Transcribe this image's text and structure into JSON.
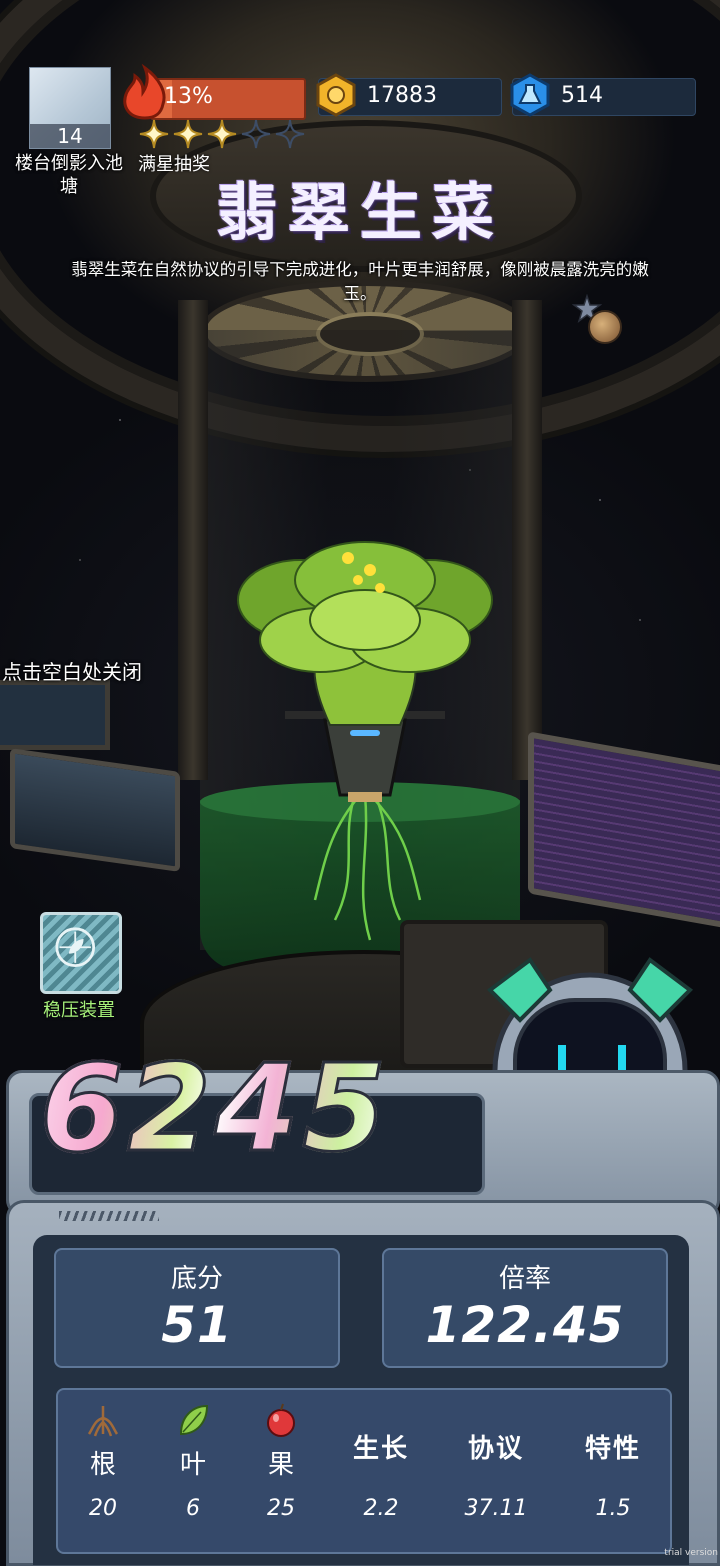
{
  "hud": {
    "level": {
      "number": "14",
      "label": "楼台倒影入池塘"
    },
    "heat": {
      "percent_text": "13%",
      "percent": 13
    },
    "stars": {
      "filled": 3,
      "total": 5,
      "label": "满星抽奖"
    },
    "coins": {
      "value": "17883",
      "icon": "gold-hexagon-coin-icon"
    },
    "gems": {
      "value": "514",
      "icon": "blue-flask-gem-icon"
    }
  },
  "plant": {
    "name": "翡翠生菜",
    "description": "翡翠生菜在自然协议的引导下完成进化，叶片更丰润舒展，像刚被晨露洗亮的嫩玉。"
  },
  "tip": "点击空白处关闭",
  "device": {
    "label": "稳压装置",
    "icon": "pressure-stabilizer-icon"
  },
  "score": {
    "total": "6245",
    "base_label": "底分",
    "base_value": "51",
    "multiplier_label": "倍率",
    "multiplier_value": "122.45"
  },
  "stats": [
    {
      "label": "根",
      "value": "20",
      "icon": "root-icon"
    },
    {
      "label": "叶",
      "value": "6",
      "icon": "leaf-icon"
    },
    {
      "label": "果",
      "value": "25",
      "icon": "apple-icon"
    },
    {
      "label": "生长",
      "value": "2.2"
    },
    {
      "label": "协议",
      "value": "37.11"
    },
    {
      "label": "特性",
      "value": "1.5"
    }
  ],
  "watermark": "trial version",
  "colors": {
    "heat_bar": "#c7512f",
    "device_label": "#a6f07a",
    "panel_card": "#354a67"
  }
}
